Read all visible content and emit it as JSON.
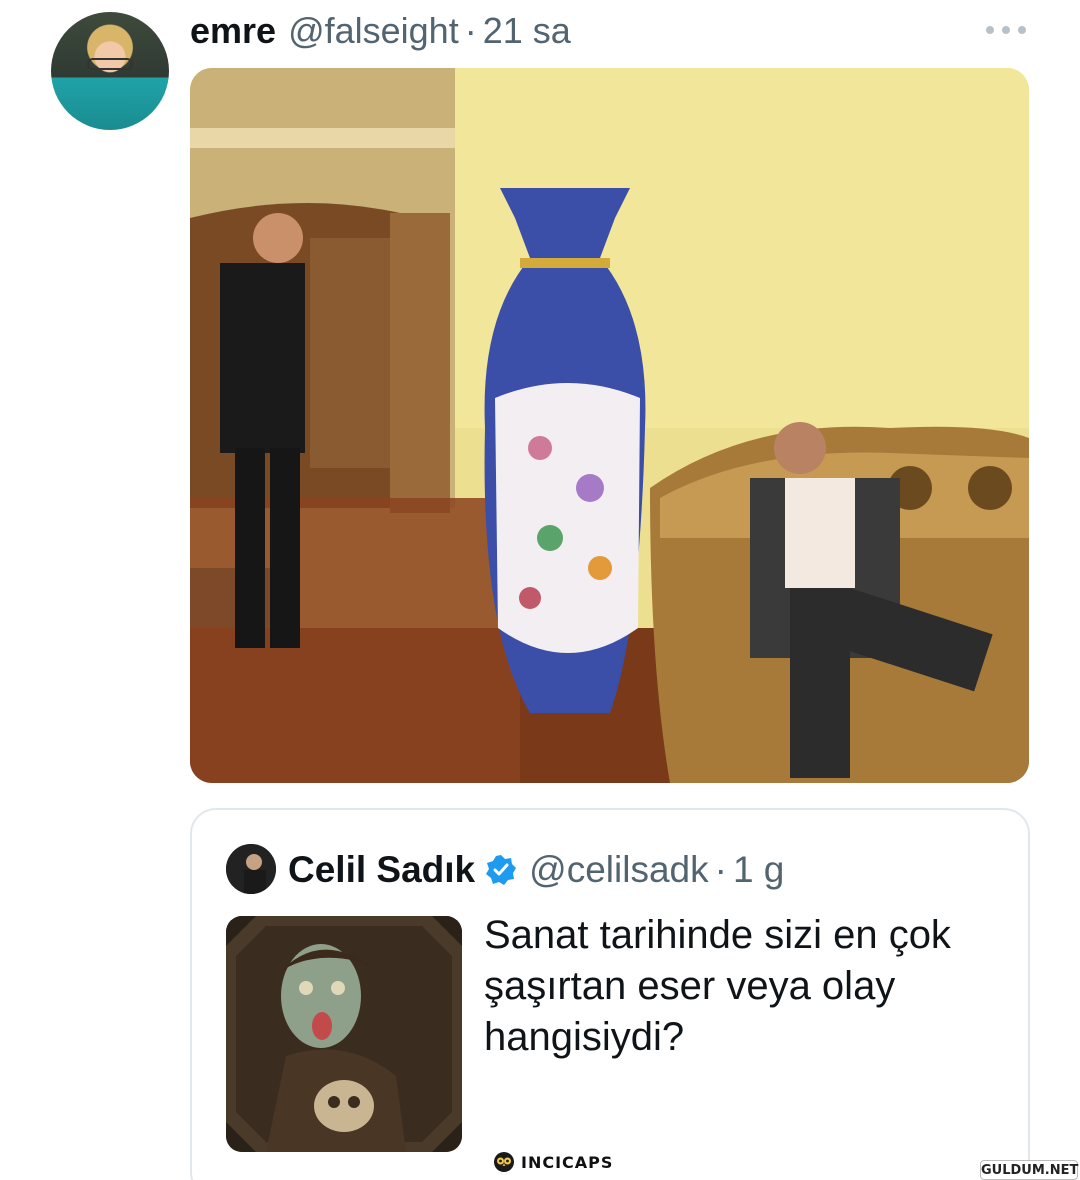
{
  "tweet": {
    "author_name": "emre",
    "author_handle": "@falseight",
    "separator": "·",
    "time": "21 sa",
    "more_icon": "more-horizontal-icon"
  },
  "quoted_tweet": {
    "author_name": "Celil Sadık",
    "verified_icon": "verified-badge-icon",
    "author_handle": "@celilsadk",
    "separator": "·",
    "time": "1 g",
    "text": "Sanat tarihinde sizi en çok şaşırtan eser veya olay hangisiydi?"
  },
  "watermarks": {
    "incicaps": "INCICAPS",
    "site": "GULDUM.NET"
  },
  "colors": {
    "text_primary": "#0f1419",
    "text_secondary": "#536471",
    "verified_blue": "#1d9bf0",
    "border": "#e1e8ed"
  }
}
